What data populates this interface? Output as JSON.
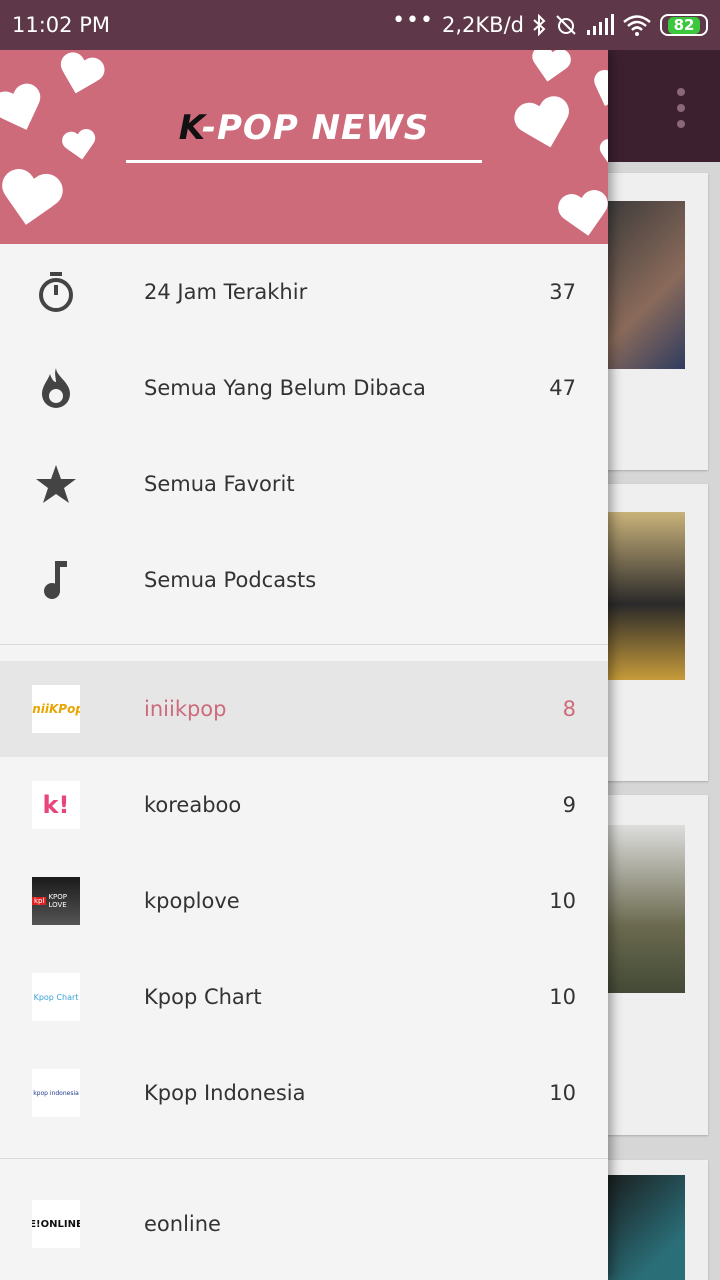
{
  "status_bar": {
    "time": "11:02 PM",
    "more": "•••",
    "network_speed": "2,2KB/d",
    "battery": "82"
  },
  "header": {
    "logo_k": "K",
    "logo_rest": "-POP NEWS"
  },
  "menu": [
    {
      "icon": "stopwatch-icon",
      "label": "24 Jam Terakhir",
      "count": "37"
    },
    {
      "icon": "fire-icon",
      "label": "Semua Yang Belum Dibaca",
      "count": "47"
    },
    {
      "icon": "star-icon",
      "label": "Semua Favorit",
      "count": ""
    },
    {
      "icon": "music-note-icon",
      "label": "Semua Podcasts",
      "count": ""
    }
  ],
  "feeds": [
    {
      "label": "iniikpop",
      "count": "8",
      "favicon": "iniiKPop",
      "active": true
    },
    {
      "label": "koreaboo",
      "count": "9",
      "favicon": "k!"
    },
    {
      "label": "kpoplove",
      "count": "10",
      "favicon_badge": "kpl",
      "favicon": "KPOP LOVE"
    },
    {
      "label": "Kpop Chart",
      "count": "10",
      "favicon": "Kpop Chart"
    },
    {
      "label": "Kpop Indonesia",
      "count": "10",
      "favicon": "kpop indonesia"
    }
  ],
  "more_feeds": [
    {
      "label": "eonline",
      "count": "",
      "favicon": "E!ONLINE"
    }
  ],
  "colors": {
    "accent": "#cd6b7b",
    "status_bar": "#5e3848"
  }
}
